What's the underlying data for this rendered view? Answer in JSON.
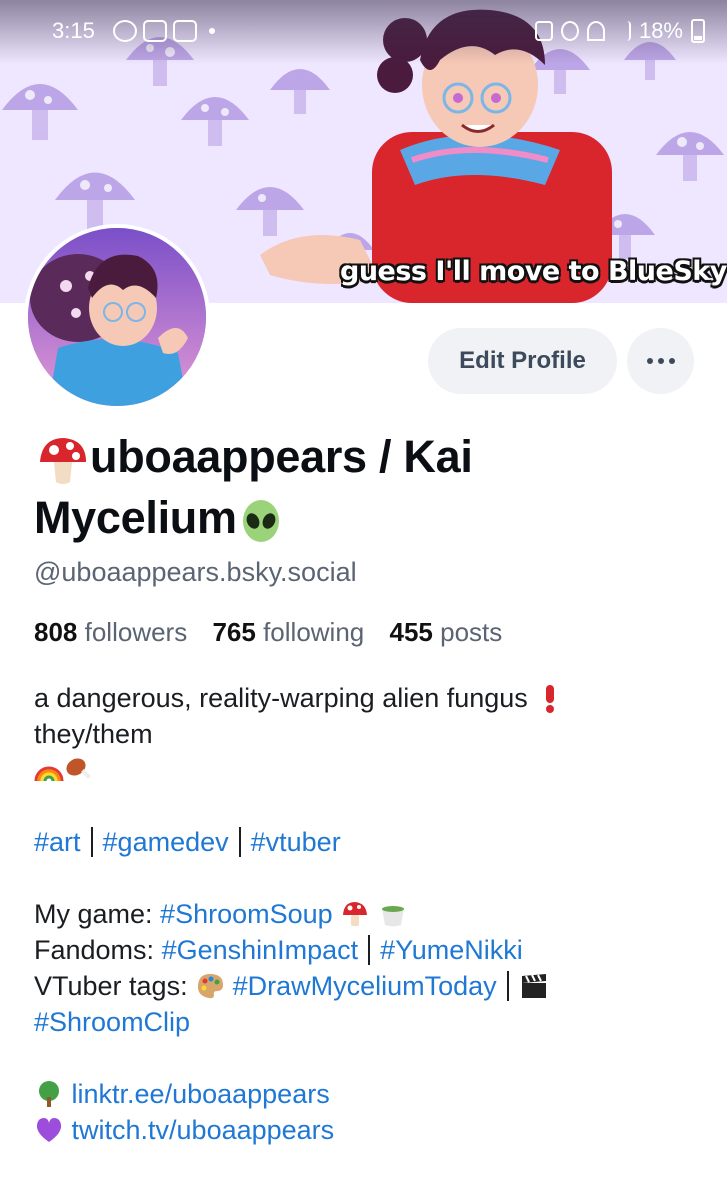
{
  "status_bar": {
    "time": "3:15",
    "battery": "18%"
  },
  "banner": {
    "caption": "guess I'll move to BlueSky",
    "colors": {
      "background": "#efe6ff",
      "mushroom": "#a78bdc",
      "shirt": "#d8262c"
    }
  },
  "profile": {
    "display_name_line1": "uboaappears / Kai",
    "display_name_line2": "Mycelium",
    "name_emoji_start": "mushroom-icon",
    "name_emoji_end": "alien-icon",
    "handle": "@uboaappears.bsky.social",
    "stats": {
      "followers_count": "808",
      "followers_label": "followers",
      "following_count": "765",
      "following_label": "following",
      "posts_count": "455",
      "posts_label": "posts"
    }
  },
  "actions": {
    "edit_profile_label": "Edit Profile",
    "more_icon": "ellipsis-icon"
  },
  "bio": {
    "line1": "a dangerous, reality-warping alien fungus",
    "line2": "they/them",
    "tags": [
      "#art",
      "#gamedev",
      "#vtuber"
    ],
    "game_prefix": "My game: ",
    "game_tag": "#ShroomSoup",
    "fandoms_prefix": "Fandoms: ",
    "fandom_tags": [
      "#GenshinImpact",
      "#YumeNikki"
    ],
    "vtuber_prefix": "VTuber tags: ",
    "vtuber_tags": [
      "#DrawMyceliumToday",
      "#ShroomClip"
    ],
    "link1": "linktr.ee/uboaappears",
    "link2": "twitch.tv/uboaappears"
  },
  "colors": {
    "link": "#1f78d4",
    "muted": "#5a6472",
    "button_bg": "#f0f2f5"
  }
}
